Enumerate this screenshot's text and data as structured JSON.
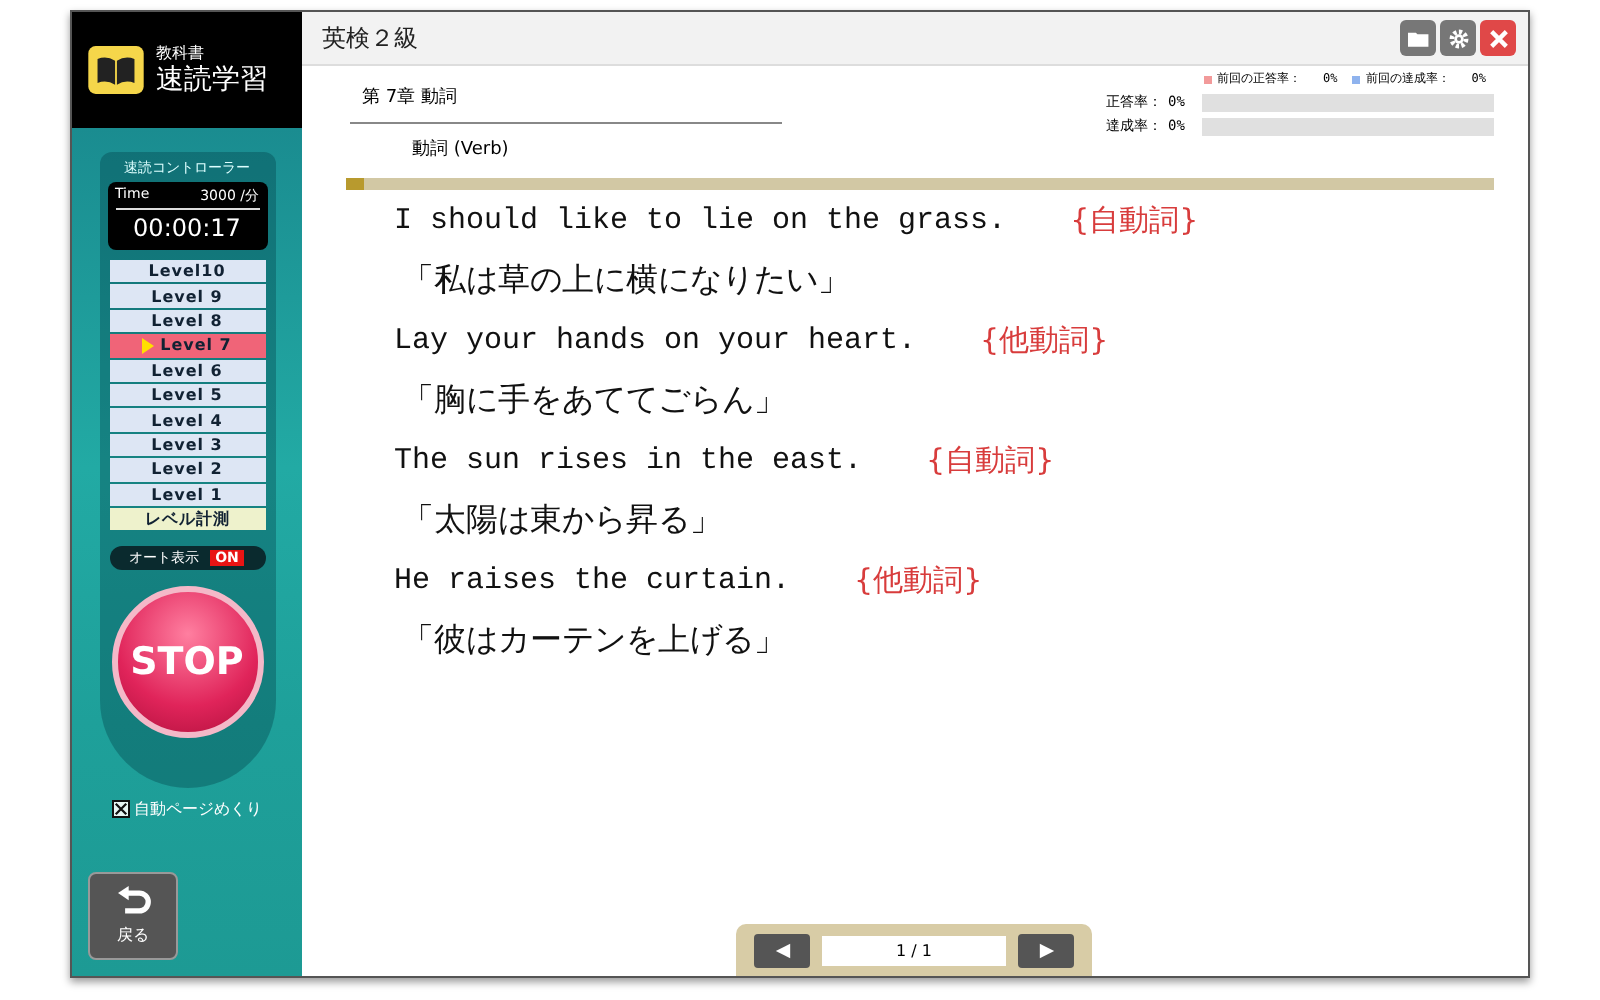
{
  "app": {
    "logo_small": "教科書",
    "logo_title": "速読学習"
  },
  "controller": {
    "title": "速読コントローラー",
    "time_label": "Time",
    "speed": "3000 /分",
    "timer": "00:00:17",
    "levels": [
      {
        "label": "Level10",
        "selected": false
      },
      {
        "label": "Level 9",
        "selected": false
      },
      {
        "label": "Level 8",
        "selected": false
      },
      {
        "label": "Level 7",
        "selected": true
      },
      {
        "label": "Level 6",
        "selected": false
      },
      {
        "label": "Level 5",
        "selected": false
      },
      {
        "label": "Level 4",
        "selected": false
      },
      {
        "label": "Level 3",
        "selected": false
      },
      {
        "label": "Level 2",
        "selected": false
      },
      {
        "label": "Level 1",
        "selected": false
      }
    ],
    "measure": "レベル計測",
    "auto_display": {
      "label": "オート表示",
      "on": true,
      "state_label": "ON"
    },
    "stop": "STOP",
    "auto_page": {
      "label": "自動ページめくり",
      "checked": true
    }
  },
  "back": "戻る",
  "window": {
    "title": "英検２級"
  },
  "header": {
    "chapter": "第 7章 動詞",
    "subtitle": "動詞 (Verb)",
    "legend": [
      {
        "label": "前回の正答率：",
        "value": "0%",
        "color": "#f29a9a"
      },
      {
        "label": "前回の達成率：",
        "value": "0%",
        "color": "#8fb3ee"
      }
    ],
    "meters": [
      {
        "label": "正答率：",
        "value": "0%",
        "level": 0
      },
      {
        "label": "達成率：",
        "value": "0%",
        "level": 0
      }
    ]
  },
  "reading_progress": {
    "level": 0.015
  },
  "sentences": [
    {
      "kind": "english",
      "text": "I should like to lie on the grass.",
      "tag": "{自動詞}"
    },
    {
      "kind": "japanese",
      "text": "「私は草の上に横になりたい」"
    },
    {
      "kind": "english",
      "text": "Lay your hands on your heart.",
      "tag": "{他動詞}"
    },
    {
      "kind": "japanese",
      "text": "「胸に手をあててごらん」"
    },
    {
      "kind": "english",
      "text": "The sun rises in the east.",
      "tag": "{自動詞}"
    },
    {
      "kind": "japanese",
      "text": "「太陽は東から昇る」"
    },
    {
      "kind": "english",
      "text": "He raises the curtain.",
      "tag": "{他動詞}"
    },
    {
      "kind": "japanese",
      "text": "「彼はカーテンを上げる」"
    }
  ],
  "pager": {
    "page": "1 / 1"
  }
}
